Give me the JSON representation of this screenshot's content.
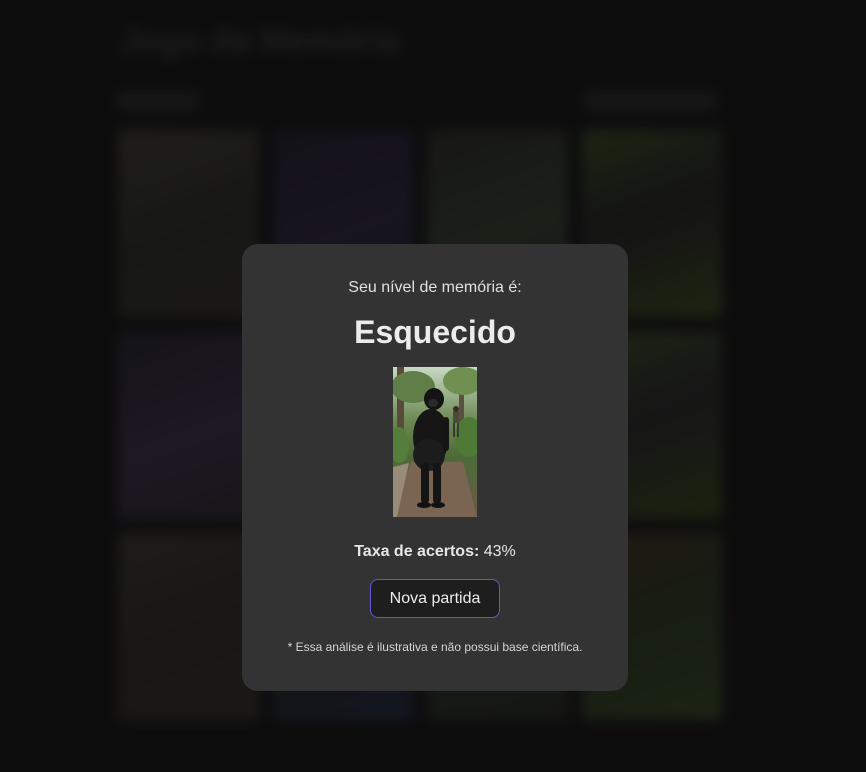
{
  "background": {
    "title": "Jogo da Memória",
    "card_count": 12
  },
  "modal": {
    "subtitle": "Seu nível de memória é:",
    "level": "Esquecido",
    "image_icon": "gorilla-photo",
    "rate_label": "Taxa de acertos:",
    "rate_value": "43%",
    "new_game_label": "Nova partida",
    "disclaimer": "* Essa análise é ilustrativa e não possui base científica.",
    "accent_color": "#5b5bd6"
  }
}
